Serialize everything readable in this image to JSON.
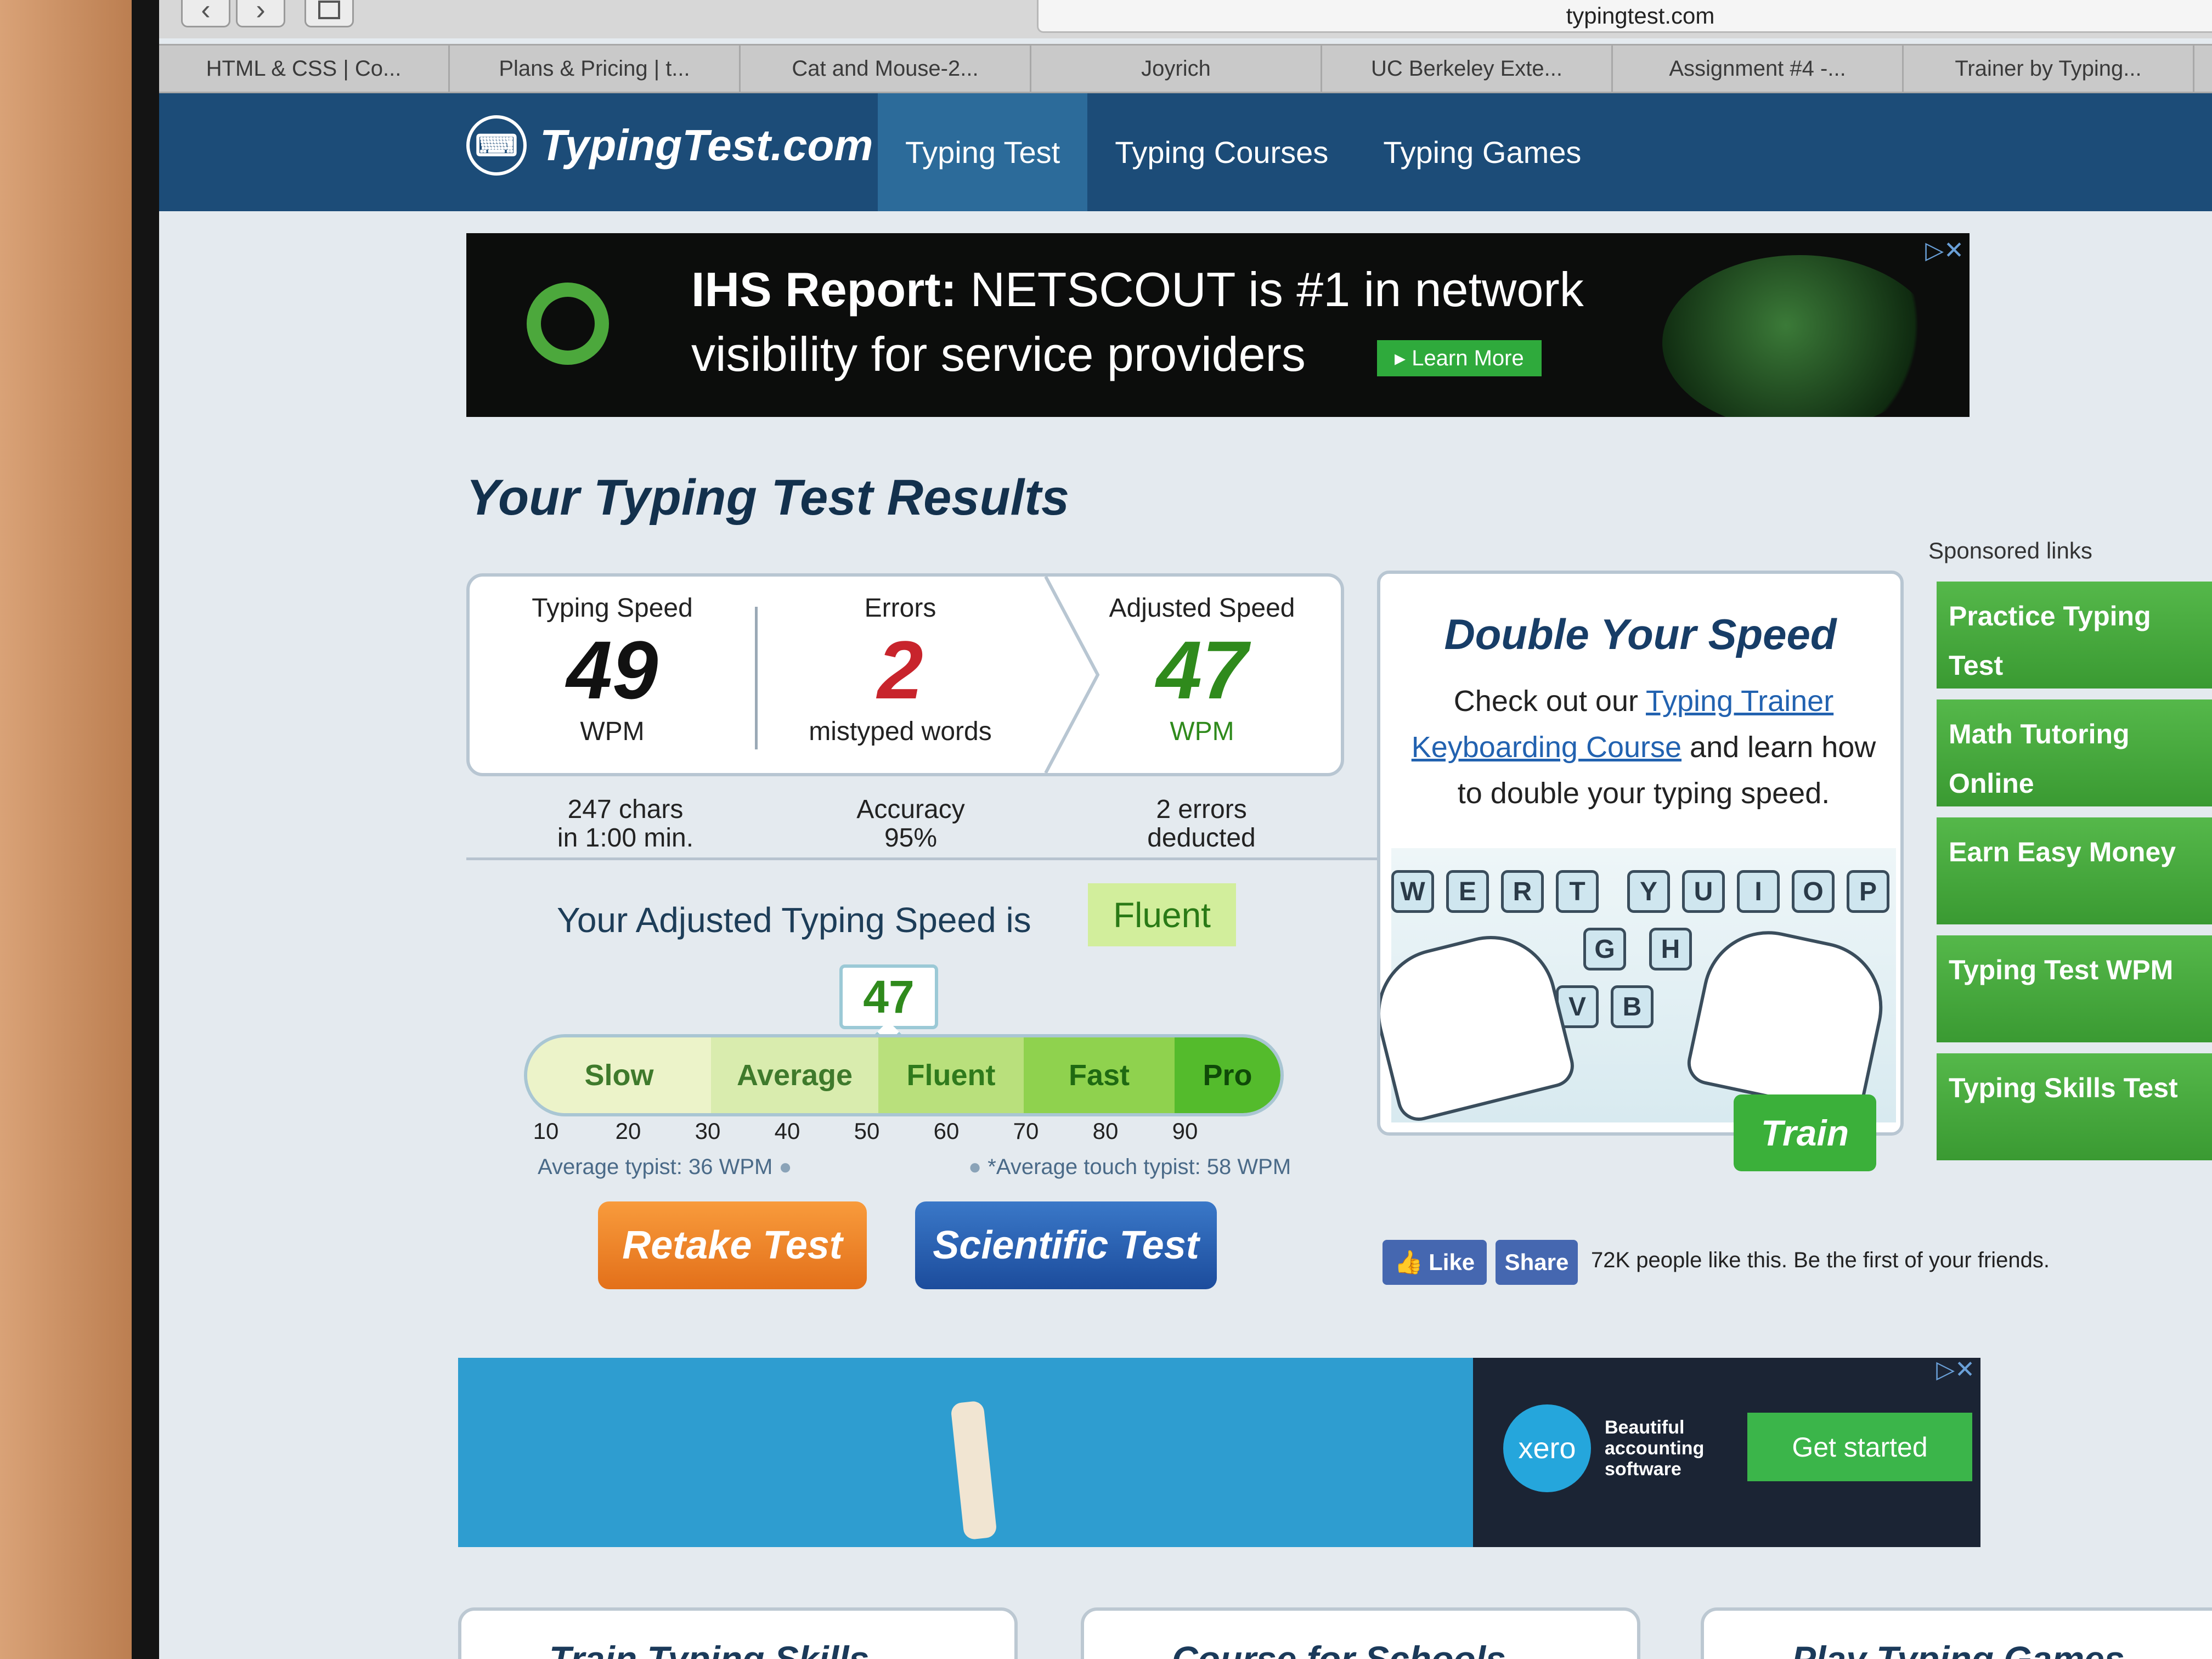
{
  "browser": {
    "url": "typingtest.com",
    "back_icon": "‹",
    "forward_icon": "›",
    "tabs": [
      "HTML & CSS | Co...",
      "Plans & Pricing | t...",
      "Cat and Mouse-2...",
      "Joyrich",
      "UC Berkeley Exte...",
      "Assignment #4 -...",
      "Trainer by Typing..."
    ]
  },
  "header": {
    "logo_text": "TypingTest.com",
    "nav": [
      "Typing Test",
      "Typing Courses",
      "Typing Games"
    ],
    "active_nav": "Typing Test"
  },
  "ad_top": {
    "line1_bold": "IHS Report:",
    "line1_rest": " NETSCOUT is #1 in network",
    "line2": "visibility for service providers",
    "cta": "▸ Learn More",
    "close": "▷✕"
  },
  "results": {
    "title": "Your Typing Test Results",
    "typing_speed": {
      "label": "Typing Speed",
      "value": "49",
      "unit": "WPM"
    },
    "errors": {
      "label": "Errors",
      "value": "2",
      "unit": "mistyped words"
    },
    "adjusted_speed": {
      "label": "Adjusted Speed",
      "value": "47",
      "unit": "WPM"
    },
    "stats": {
      "chars_line1": "247 chars",
      "chars_line2": "in 1:00 min.",
      "accuracy_line1": "Accuracy",
      "accuracy_line2": "95%",
      "errors_line1": "2 errors",
      "errors_line2": "deducted"
    },
    "adjusted_text": "Your Adjusted Typing Speed is",
    "level": "Fluent",
    "marker_value": "47",
    "scale_segments": [
      {
        "label": "Slow",
        "color": "#ecf3c9",
        "text_color": "#3f7a2c"
      },
      {
        "label": "Average",
        "color": "#d9ecae",
        "text_color": "#3f7a2c"
      },
      {
        "label": "Fluent",
        "color": "#b9e07c",
        "text_color": "#2f7a1c"
      },
      {
        "label": "Fast",
        "color": "#8fd24e",
        "text_color": "#1f6a12"
      },
      {
        "label": "Pro",
        "color": "#54bb2c",
        "text_color": "#0f4a08"
      }
    ],
    "ticks": [
      "10",
      "20",
      "30",
      "40",
      "50",
      "60",
      "70",
      "80",
      "90"
    ],
    "avg_typist": "Average typist: 36 WPM",
    "avg_touch": "*Average touch typist: 58 WPM",
    "retake_label": "Retake Test",
    "scientific_label": "Scientific Test"
  },
  "promo": {
    "title": "Double Your Speed",
    "text_before": "Check out our ",
    "link1": "Typing Trainer",
    "link2": "Keyboarding Course",
    "text_after": " and learn how to double your typing speed.",
    "keys_top": [
      "W",
      "E",
      "R",
      "T",
      "Y",
      "U",
      "I",
      "O",
      "P"
    ],
    "keys_mid": [
      "G",
      "H"
    ],
    "keys_bot": [
      "V",
      "B"
    ],
    "train_label": "Train"
  },
  "social": {
    "like_label": "Like",
    "share_label": "Share",
    "text": "72K people like this. Be the first of your friends."
  },
  "sponsored": {
    "label": "Sponsored links",
    "items": [
      "Practice Typing Test",
      "Math Tutoring Online",
      "Earn Easy Money",
      "Typing Test WPM",
      "Typing Skills Test"
    ]
  },
  "ad_bottom": {
    "logo": "xero",
    "tagline_1": "Beautiful",
    "tagline_2": "accounting",
    "tagline_3": "software",
    "cta": "Get started",
    "close": "▷✕"
  },
  "bottom_cards": [
    "Train Typing Skills",
    "Course for Schools",
    "Play Typing Games"
  ]
}
